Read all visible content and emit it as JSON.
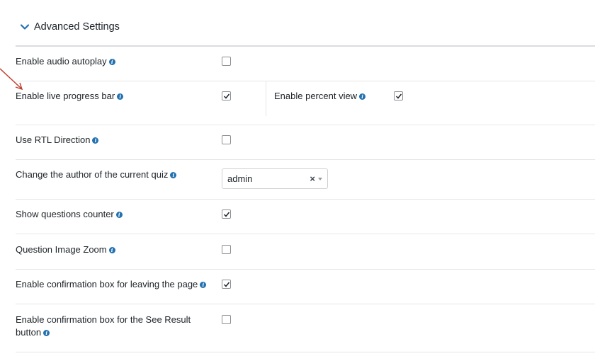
{
  "section": {
    "title": "Advanced Settings",
    "icon": "chevron-down-icon",
    "expanded": true
  },
  "colors": {
    "accent": "#2271b1",
    "arrow": "#c0392b",
    "info_icon": "#2271b1"
  },
  "info_icon_name": "info-icon",
  "rows": {
    "audio_autoplay": {
      "label": "Enable audio autoplay",
      "checked": false
    },
    "live_progress": {
      "label": "Enable live progress bar",
      "checked": true
    },
    "percent_view": {
      "label": "Enable percent view",
      "checked": true
    },
    "rtl": {
      "label": "Use RTL Direction",
      "checked": false
    },
    "change_author": {
      "label": "Change the author of the current quiz",
      "value": "admin"
    },
    "questions_counter": {
      "label": "Show questions counter",
      "checked": true
    },
    "image_zoom": {
      "label": "Question Image Zoom",
      "checked": false
    },
    "confirm_leave": {
      "label": "Enable confirmation box for leaving the page",
      "checked": true
    },
    "confirm_result_line1": {
      "label": "Enable confirmation box for the See Result"
    },
    "confirm_result_line2": {
      "label": "button",
      "checked": false
    }
  }
}
